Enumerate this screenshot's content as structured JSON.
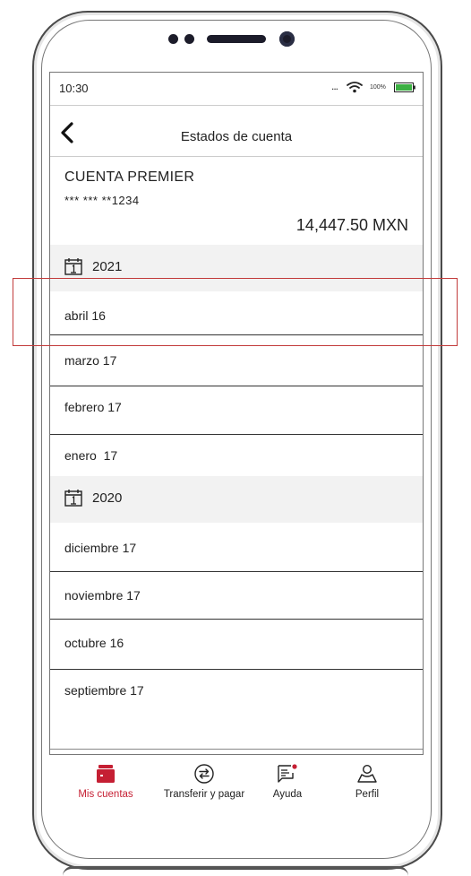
{
  "status_bar": {
    "time": "10:30",
    "signal_dots": "...",
    "battery_text": "100%"
  },
  "header": {
    "title": "Estados de cuenta"
  },
  "account": {
    "name": "CUENTA PREMIER",
    "number": "*** *** **1234",
    "balance": "14,447.50 MXN"
  },
  "statements": [
    {
      "year": "2021",
      "months": [
        "abril 16",
        "marzo 17",
        "febrero 17",
        "enero  17"
      ]
    },
    {
      "year": "2020",
      "months": [
        "diciembre 17",
        "noviembre 17",
        "octubre 16",
        "septiembre 17"
      ]
    }
  ],
  "bottom_nav": [
    {
      "label": "Mis cuentas",
      "icon": "wallet-icon",
      "active": true
    },
    {
      "label": "Transferir y pagar",
      "icon": "transfer-icon",
      "active": false
    },
    {
      "label": "Ayuda",
      "icon": "help-chat-icon",
      "active": false
    },
    {
      "label": "Perfil",
      "icon": "profile-icon",
      "active": false
    }
  ],
  "colors": {
    "accent": "#c51f33",
    "highlight": "#c23b3b",
    "battery": "#3cb043"
  }
}
